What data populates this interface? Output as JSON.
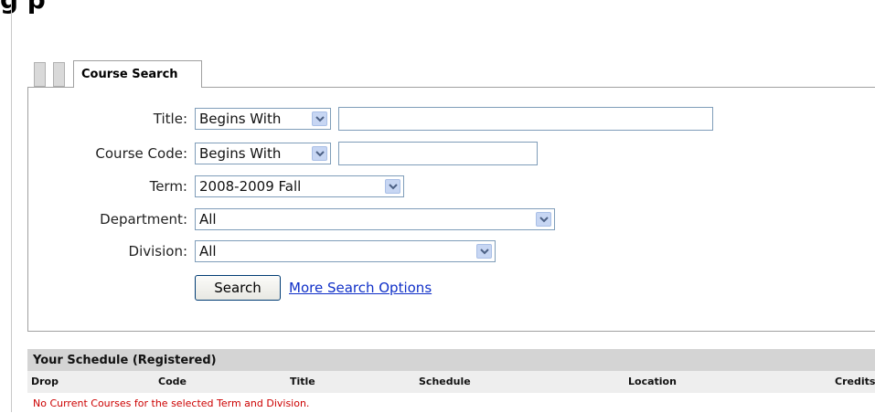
{
  "page": {
    "heading": "g      p"
  },
  "tabs": [
    {
      "label": ""
    },
    {
      "label": ""
    },
    {
      "label": "Course Search",
      "active": true
    }
  ],
  "search_form": {
    "title_label": "Title:",
    "title_match": "Begins With",
    "title_value": "",
    "code_label": "Course Code:",
    "code_match": "Begins With",
    "code_value": "",
    "term_label": "Term:",
    "term_value": "2008-2009 Fall",
    "department_label": "Department:",
    "department_value": "All",
    "division_label": "Division:",
    "division_value": "All",
    "search_button": "Search",
    "more_options_link": "More Search Options"
  },
  "schedule": {
    "title": "Your Schedule (Registered)",
    "columns": [
      "Drop",
      "Code",
      "Title",
      "Schedule",
      "Location",
      "Credits"
    ],
    "empty_message": "No Current Courses for the selected Term and Division."
  },
  "colors": {
    "link": "#1030c8",
    "error": "#cc0000",
    "header_bg": "#d4d4d4",
    "input_border": "#7f9db9",
    "dropdown_arrow_bg": "#c7d6f3"
  },
  "icons": {
    "dropdown": "chevron-down-icon"
  }
}
